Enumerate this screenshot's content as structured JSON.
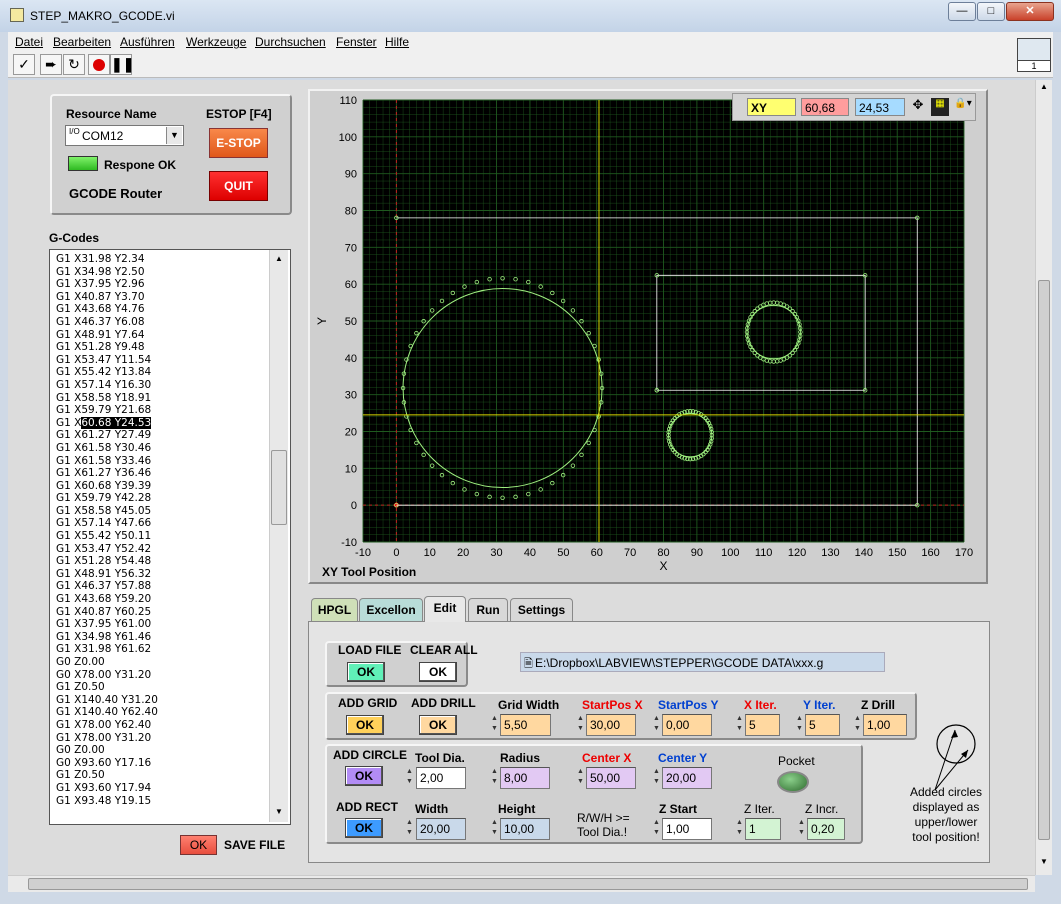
{
  "window": {
    "title": "STEP_MAKRO_GCODE.vi"
  },
  "menu": [
    "Datei",
    "Bearbeiten",
    "Ausführen",
    "Werkzeuge",
    "Durchsuchen",
    "Fenster",
    "Hilfe"
  ],
  "toolbar_icons": [
    "run-check-icon",
    "run-arrow-icon",
    "run-continuous-icon",
    "abort-icon",
    "pause-icon"
  ],
  "corner_icon_label": "1",
  "resource": {
    "label": "Resource Name",
    "value": "COM12",
    "prefix": "I/O",
    "led_label": "Respone OK",
    "router_label": "GCODE Router"
  },
  "estop": {
    "label": "ESTOP [F4]",
    "button": "E-STOP",
    "quit": "QUIT"
  },
  "gcodes": {
    "label": "G-Codes",
    "lines": [
      "G1 X31.98 Y2.34",
      "G1 X34.98 Y2.50",
      "G1 X37.95 Y2.96",
      "G1 X40.87 Y3.70",
      "G1 X43.68 Y4.76",
      "G1 X46.37 Y6.08",
      "G1 X48.91 Y7.64",
      "G1 X51.28 Y9.48",
      "G1 X53.47 Y11.54",
      "G1 X55.42 Y13.84",
      "G1 X57.14 Y16.30",
      "G1 X58.58 Y18.91",
      "G1 X59.79 Y21.68",
      "G1 X60.68 Y24.53",
      "G1 X61.27 Y27.49",
      "G1 X61.58 Y30.46",
      "G1 X61.58 Y33.46",
      "G1 X61.27 Y36.46",
      "G1 X60.68 Y39.39",
      "G1 X59.79 Y42.28",
      "G1 X58.58 Y45.05",
      "G1 X57.14 Y47.66",
      "G1 X55.42 Y50.11",
      "G1 X53.47 Y52.42",
      "G1 X51.28 Y54.48",
      "G1 X48.91 Y56.32",
      "G1 X46.37 Y57.88",
      "G1 X43.68 Y59.20",
      "G1 X40.87 Y60.25",
      "G1 X37.95 Y61.00",
      "G1 X34.98 Y61.46",
      "G1 X31.98 Y61.62",
      "G0 Z0.00",
      "G0 X78.00 Y31.20",
      "G1 Z0.50",
      "G1 X140.40 Y31.20",
      "G1 X140.40 Y62.40",
      "G1 X78.00 Y62.40",
      "G1 X78.00 Y31.20",
      "G0 Z0.00",
      "G0 X93.60 Y17.16",
      "G1 Z0.50",
      "G1 X93.60 Y17.94",
      "G1 X93.48 Y19.15"
    ],
    "selected_prefix": "G1 X",
    "selected_highlight": "60.68 Y24.53"
  },
  "save": {
    "button": "OK",
    "label": "SAVE FILE"
  },
  "plot": {
    "cursor_label": "XY",
    "cursor_x": "60,68",
    "cursor_y": "24,53",
    "title": "XY Tool Position",
    "xlabel": "X",
    "ylabel": "Y",
    "xticks": [
      "-10",
      "0",
      "10",
      "20",
      "30",
      "40",
      "50",
      "60",
      "70",
      "80",
      "90",
      "100",
      "110",
      "120",
      "130",
      "140",
      "150",
      "160",
      "170"
    ],
    "yticks": [
      "-10",
      "0",
      "10",
      "20",
      "30",
      "40",
      "50",
      "60",
      "70",
      "80",
      "90",
      "100",
      "110"
    ]
  },
  "chart_data": {
    "type": "line",
    "title": "XY Tool Position",
    "xlabel": "X",
    "ylabel": "Y",
    "xlim": [
      -10,
      170
    ],
    "ylim": [
      -10,
      110
    ],
    "grid": true,
    "cursor": {
      "x": 60.68,
      "y": 24.53
    },
    "series": [
      {
        "values": [
          [
            0,
            78
          ],
          [
            156,
            78
          ],
          [
            156,
            0
          ],
          [
            0,
            0
          ]
        ]
      },
      {
        "values": [
          [
            78,
            31.2
          ],
          [
            140.4,
            31.2
          ],
          [
            140.4,
            62.4
          ],
          [
            78,
            62.4
          ],
          [
            78,
            31.2
          ]
        ]
      },
      {
        "circle": {
          "cx": 31.8,
          "cy": 31.8,
          "r": 29.8
        }
      },
      {
        "circle": {
          "cx": 113,
          "cy": 47,
          "r": 8
        }
      },
      {
        "circle": {
          "cx": 88,
          "cy": 19,
          "r": 6.5
        }
      }
    ]
  },
  "tabs": [
    {
      "label": "HPGL",
      "color": "#cfe0b8"
    },
    {
      "label": "Excellon",
      "color": "#b8dcd8"
    },
    {
      "label": "Edit",
      "color": "#e8e8e8"
    },
    {
      "label": "Run",
      "color": "#d8d8d8"
    },
    {
      "label": "Settings",
      "color": "#d8d8d8"
    }
  ],
  "edit": {
    "load_file": "LOAD FILE",
    "clear_all": "CLEAR ALL",
    "ok": "OK",
    "path": "E:\\Dropbox\\LABVIEW\\STEPPER\\GCODE DATA\\xxx.g",
    "add_grid": "ADD GRID",
    "add_drill": "ADD DRILL",
    "grid_width": {
      "label": "Grid Width",
      "value": "5,50"
    },
    "startpos_x": {
      "label": "StartPos X",
      "value": "30,00"
    },
    "startpos_y": {
      "label": "StartPos Y",
      "value": "0,00"
    },
    "x_iter": {
      "label": "X Iter.",
      "value": "5"
    },
    "y_iter": {
      "label": "Y Iter.",
      "value": "5"
    },
    "z_drill": {
      "label": "Z Drill",
      "value": "1,00"
    },
    "add_circle": "ADD CIRCLE",
    "tool_dia": {
      "label": "Tool Dia.",
      "value": "2,00"
    },
    "radius": {
      "label": "Radius",
      "value": "8,00"
    },
    "center_x": {
      "label": "Center X",
      "value": "50,00"
    },
    "center_y": {
      "label": "Center Y",
      "value": "20,00"
    },
    "pocket": "Pocket",
    "add_rect": "ADD RECT",
    "width": {
      "label": "Width",
      "value": "20,00"
    },
    "height": {
      "label": "Height",
      "value": "10,00"
    },
    "rwh_note": "R/W/H >= Tool Dia.!",
    "z_start": {
      "label": "Z Start",
      "value": "1,00"
    },
    "z_iter": {
      "label": "Z Iter.",
      "value": "1"
    },
    "z_incr": {
      "label": "Z Incr.",
      "value": "0,20"
    },
    "circle_note": "Added circles displayed as upper/lower tool position!"
  },
  "colors": {
    "plot_bg": "#000000",
    "grid": "#1f5a1f",
    "trace": "#9fef80",
    "white_trace": "#ffffff",
    "cursor_line": "#d8d800",
    "origin_line": "#c02020"
  }
}
